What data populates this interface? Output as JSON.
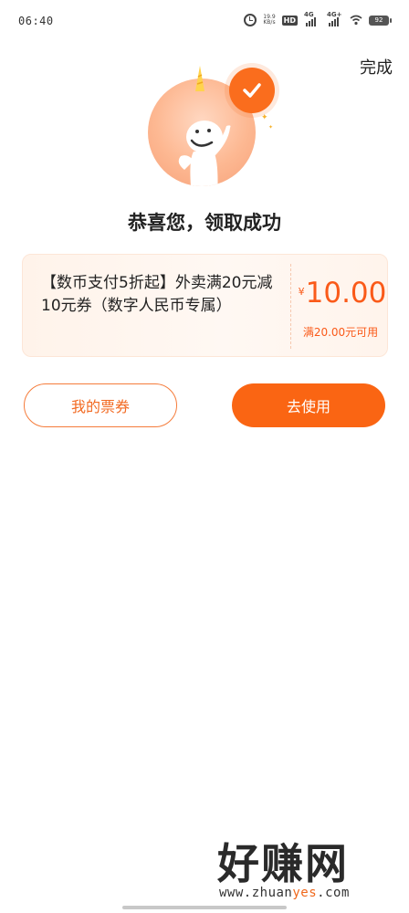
{
  "status_bar": {
    "time": "06:40",
    "net_speed_value": "19.9",
    "net_speed_unit": "KB/s",
    "hd_label": "HD",
    "sim1_label": "4G",
    "sim2_label": "4G+",
    "battery": "92"
  },
  "header": {
    "done_label": "完成"
  },
  "success": {
    "title": "恭喜您，领取成功"
  },
  "coupon": {
    "title": "【数币支付5折起】外卖满20元减10元券（数字人民币专属）",
    "currency_symbol": "¥",
    "amount": "10.00",
    "condition": "满20.00元可用"
  },
  "actions": {
    "my_coupons_label": "我的票券",
    "use_now_label": "去使用"
  },
  "watermark": {
    "main_text": "好赚网",
    "site_prefix": "www.zhuan",
    "site_accent": "yes",
    "site_suffix": ".com"
  },
  "colors": {
    "accent": "#fa6513",
    "price": "#fa5a19",
    "card_bg": "#fff3ea"
  },
  "icons": {
    "check_badge": "check-icon",
    "mascot": "unicorn-mascot-icon"
  }
}
